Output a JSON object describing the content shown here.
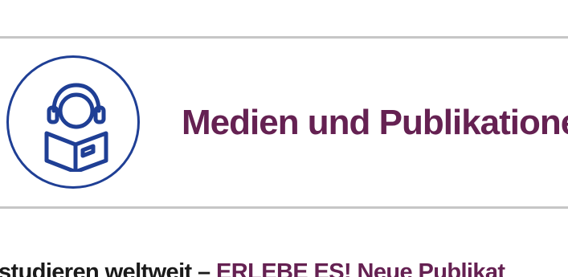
{
  "section": {
    "icon": "reading-person-headphones-icon",
    "title": "Medien und Publikatione"
  },
  "teaser": {
    "part1": "studieren weltweit – ",
    "part2": "ERLEBE ES! Neue Publikat"
  },
  "colors": {
    "title": "#652152",
    "icon_stroke": "#1f3f95",
    "divider": "#c6c6c6",
    "teaser_text": "#1a1a1a"
  }
}
